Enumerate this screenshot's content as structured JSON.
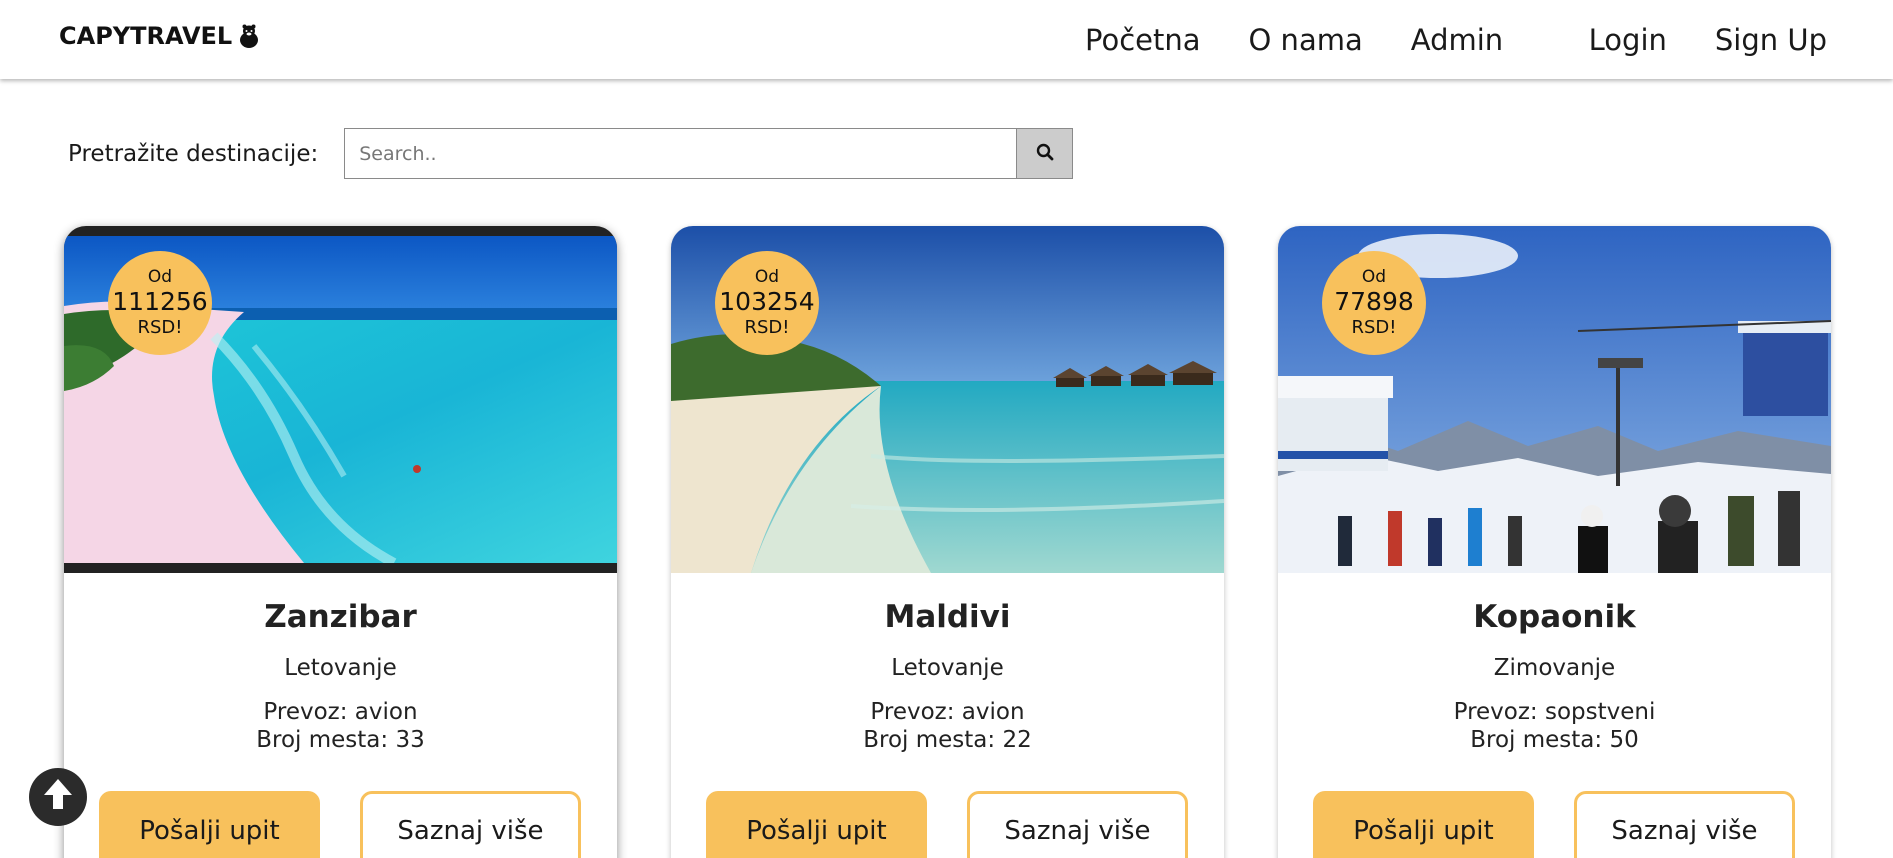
{
  "brand": {
    "name": "CAPYTRAVEL",
    "logo_icon": "capybara-icon"
  },
  "nav": {
    "left": [
      {
        "label": "Početna"
      },
      {
        "label": "O nama"
      },
      {
        "label": "Admin"
      }
    ],
    "right": [
      {
        "label": "Login"
      },
      {
        "label": "Sign Up"
      }
    ]
  },
  "search": {
    "label": "Pretražite destinacije:",
    "placeholder": "Search..",
    "value": "",
    "button_icon": "search-icon"
  },
  "colors": {
    "accent": "#f8c15c",
    "navbar_bg": "#ffffff",
    "search_button_bg": "#cccccc",
    "scroll_top_bg": "#2b2b2b"
  },
  "cards": [
    {
      "price_prefix": "Od",
      "price": "111256",
      "currency": "RSD!",
      "title": "Zanzibar",
      "type": "Letovanje",
      "transport": "Prevoz: avion",
      "seats": "Broj mesta: 33",
      "primary_label": "Pošalji upit",
      "secondary_label": "Saznaj više",
      "image": "tropical beach with turquoise water"
    },
    {
      "price_prefix": "Od",
      "price": "103254",
      "currency": "RSD!",
      "title": "Maldivi",
      "type": "Letovanje",
      "transport": "Prevoz: avion",
      "seats": "Broj mesta: 22",
      "primary_label": "Pošalji upit",
      "secondary_label": "Saznaj više",
      "image": "white sand beach with overwater bungalows"
    },
    {
      "price_prefix": "Od",
      "price": "77898",
      "currency": "RSD!",
      "title": "Kopaonik",
      "type": "Zimovanje",
      "transport": "Prevoz: sopstveni",
      "seats": "Broj mesta: 50",
      "primary_label": "Pošalji upit",
      "secondary_label": "Saznaj više",
      "image": "ski resort with skiers and lift"
    }
  ],
  "scroll_top": {
    "icon": "arrow-up-icon"
  }
}
